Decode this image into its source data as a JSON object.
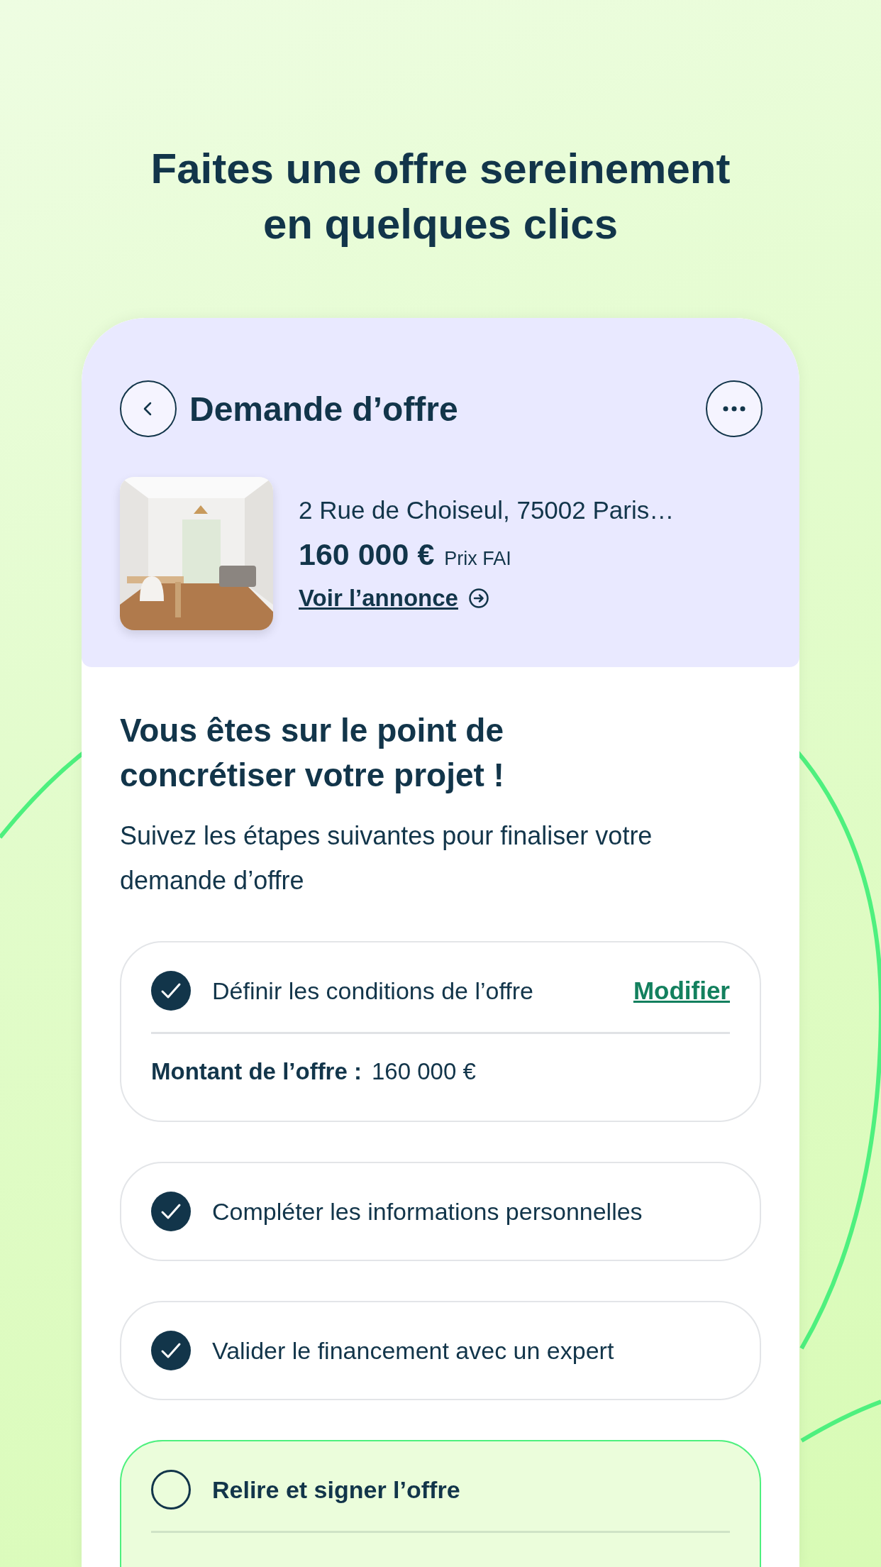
{
  "headline": "Faites une offre sereinement en quelques clics",
  "header": {
    "title": "Demande d’offre",
    "listing": {
      "address": "2 Rue de Choiseul, 75002 Paris…",
      "price": "160 000 €",
      "price_note": "Prix FAI",
      "link": "Voir l’annonce"
    }
  },
  "intro": {
    "title": "Vous êtes sur le point de concrétiser votre projet !",
    "text": "Suivez les étapes suivantes pour finaliser votre demande d’offre"
  },
  "steps": [
    {
      "label": "Définir les conditions de l’offre",
      "done": true,
      "active": false,
      "action": "Modifier",
      "detail": {
        "label": "Montant de l’offre :",
        "value": "160 000 €"
      }
    },
    {
      "label": "Compléter les informations personnelles",
      "done": true,
      "active": false
    },
    {
      "label": "Valider le financement avec un expert",
      "done": true,
      "active": false
    },
    {
      "label": "Relire et signer l’offre",
      "done": false,
      "active": true
    }
  ]
}
